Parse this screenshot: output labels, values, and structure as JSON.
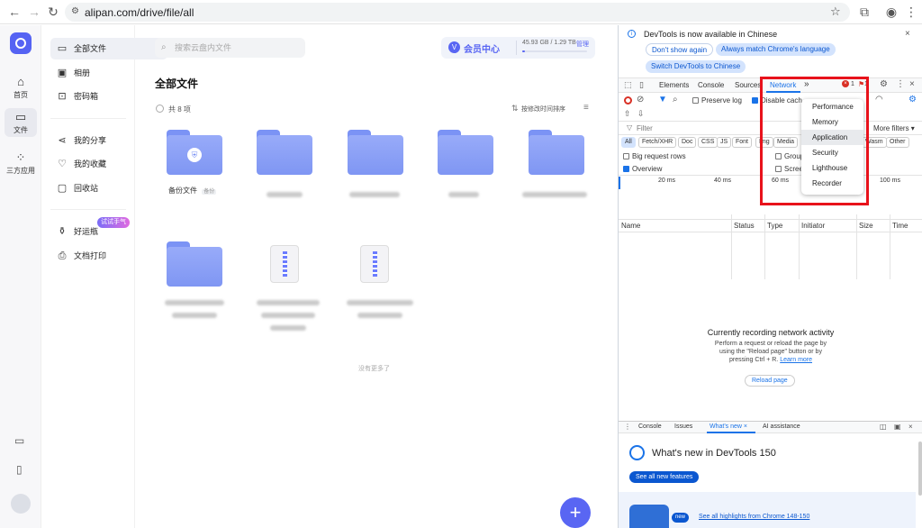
{
  "browser": {
    "url": "alipan.com/drive/file/all"
  },
  "rail": {
    "home": "首页",
    "files": "文件",
    "apps": "三方应用"
  },
  "nav": {
    "all_files": "全部文件",
    "albums": "相册",
    "passwords": "密码箱",
    "my_shares": "我的分享",
    "favorites": "我的收藏",
    "recycle": "回收站",
    "haoyunping": "好运瓶",
    "trial_badge": "试试手气",
    "print": "文档打印"
  },
  "main": {
    "search_placeholder": "搜索云盘内文件",
    "member_label": "会员中心",
    "storage_text": "45.93 GB / 1.29 TB",
    "manage_label": "管理",
    "storage_fraction": 0.035,
    "title": "全部文件",
    "count_text": "共 8 项",
    "sort_label": "按修改时间排序",
    "backup_folder": "备份文件",
    "backup_tag": "备份",
    "end_text": "没有更多了"
  },
  "devtools": {
    "banner_title": "DevTools is now available in Chinese",
    "btn_dont_show": "Don't show again",
    "btn_match": "Always match Chrome's language",
    "btn_switch": "Switch DevTools to Chinese",
    "tabs": [
      "Elements",
      "Console",
      "Sources",
      "Network"
    ],
    "more_tabs": "»",
    "error_count": "1",
    "warn_count": "1",
    "preserve_log": "Preserve log",
    "disable_cache": "Disable cach",
    "filter_placeholder": "Filter",
    "more_filters": "More filters",
    "filter_chips": [
      "All",
      "Fetch/XHR",
      "Doc",
      "CSS",
      "JS",
      "Font",
      "Img",
      "Media",
      "Wasm",
      "Other"
    ],
    "big_rows": "Big request rows",
    "overview": "Overview",
    "group": "Group",
    "screen": "Screen",
    "timeline": [
      "20 ms",
      "40 ms",
      "60 ms",
      "100 ms"
    ],
    "columns": [
      "Name",
      "Status",
      "Type",
      "Initiator",
      "Size",
      "Time"
    ],
    "recording_title": "Currently recording network activity",
    "recording_l1": "Perform a request or reload the page by",
    "recording_l2": "using the \"Reload page\" button or by",
    "recording_l3": "pressing Ctrl + R.",
    "learn_more": "Learn more",
    "reload_btn": "Reload page",
    "menu_items": [
      "Performance",
      "Memory",
      "Application",
      "Security",
      "Lighthouse",
      "Recorder"
    ],
    "drawer_tabs": [
      "Console",
      "Issues",
      "What's new",
      "AI assistance"
    ],
    "whats_new_title": "What's new in DevTools 150",
    "see_all": "See all new features",
    "new_badge": "new",
    "highlights": "See all highlights from Chrome 148-150"
  },
  "colors": {
    "accent": "#5966f3",
    "folder": "#8ea2f7",
    "devtools_blue": "#1a73e8",
    "highlight_red": "#e8121b"
  }
}
